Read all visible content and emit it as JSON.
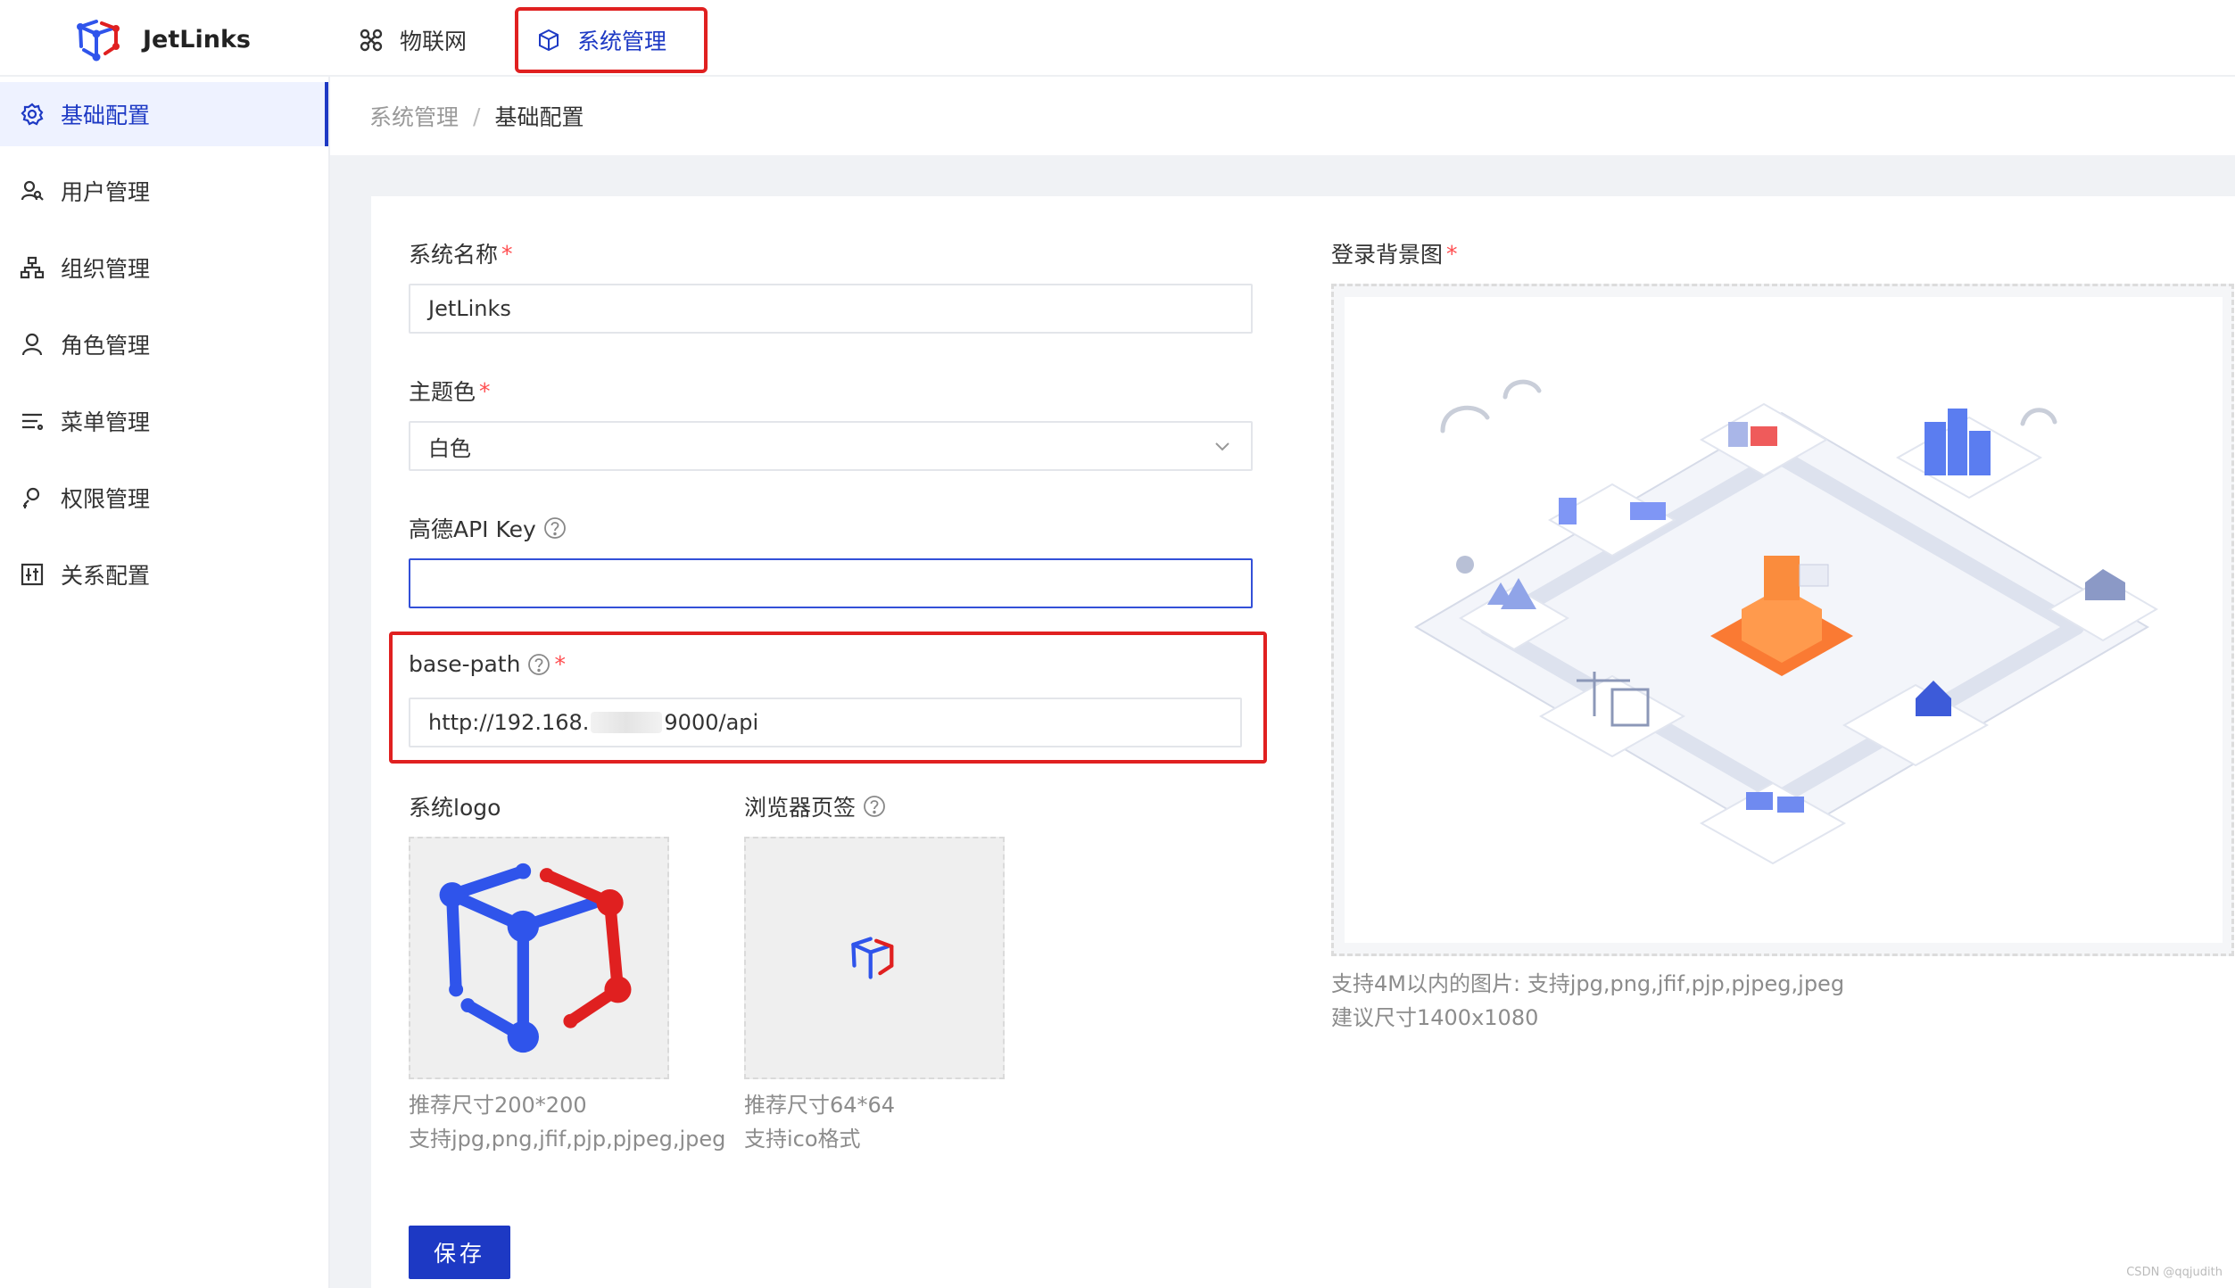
{
  "header": {
    "brand": "JetLinks",
    "nav": [
      {
        "label": "物联网",
        "icon": "iot-icon"
      },
      {
        "label": "系统管理",
        "icon": "cube-icon",
        "active": true
      }
    ]
  },
  "sidebar": {
    "items": [
      {
        "label": "基础配置",
        "icon": "gear-icon",
        "active": true
      },
      {
        "label": "用户管理",
        "icon": "users-icon"
      },
      {
        "label": "组织管理",
        "icon": "org-tree-icon"
      },
      {
        "label": "角色管理",
        "icon": "user-icon"
      },
      {
        "label": "菜单管理",
        "icon": "menu-icon"
      },
      {
        "label": "权限管理",
        "icon": "key-user-icon"
      },
      {
        "label": "关系配置",
        "icon": "relation-icon"
      }
    ]
  },
  "breadcrumb": {
    "parent": "系统管理",
    "separator": "/",
    "current": "基础配置"
  },
  "form": {
    "system_name": {
      "label": "系统名称",
      "required": "*",
      "value": "JetLinks"
    },
    "theme": {
      "label": "主题色",
      "required": "*",
      "value": "白色"
    },
    "amap_key": {
      "label": "高德API Key",
      "value": ""
    },
    "base_path": {
      "label": "base-path",
      "required": "*",
      "value_prefix": "http://192.168.",
      "value_suffix": "9000/api"
    },
    "logo": {
      "label": "系统logo",
      "hint1": "推荐尺寸200*200",
      "hint2": "支持jpg,png,jfif,pjp,pjpeg,jpeg"
    },
    "favicon": {
      "label": "浏览器页签",
      "hint1": "推荐尺寸64*64",
      "hint2": "支持ico格式"
    },
    "login_bg": {
      "label": "登录背景图",
      "required": "*",
      "hint1": "支持4M以内的图片: 支持jpg,png,jfif,pjp,pjpeg,jpeg",
      "hint2": "建议尺寸1400x1080"
    },
    "save_label": "保存"
  },
  "watermark": "CSDN @qqjudith",
  "colors": {
    "primary": "#1d39c4",
    "highlight": "#e02020",
    "required": "#ff4d4f"
  }
}
